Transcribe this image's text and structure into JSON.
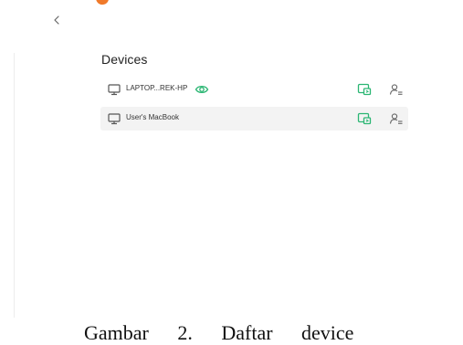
{
  "nav": {
    "back_glyph": "‹"
  },
  "devices": {
    "title": "Devices",
    "items": [
      {
        "name": "LAPTOP...REK-HP",
        "icon": "monitor-icon",
        "current": true
      },
      {
        "name": "User's MacBook",
        "icon": "monitor-icon",
        "current": false
      }
    ]
  },
  "caption": {
    "text": "Gambar 2. Daftar device"
  },
  "colors": {
    "accent_green": "#2bb673",
    "icon_gray": "#555555",
    "orange_accent": "#f07a2a"
  }
}
